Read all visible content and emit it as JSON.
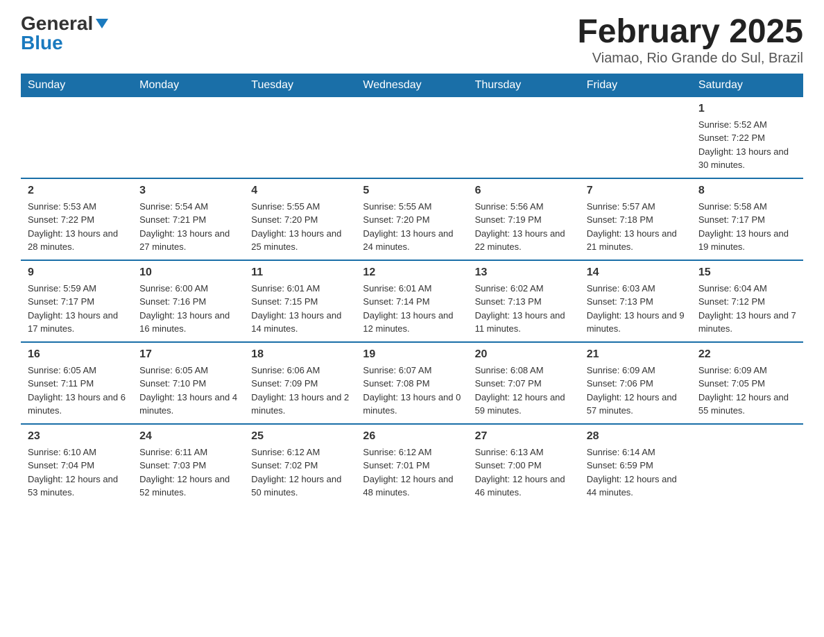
{
  "logo": {
    "general": "General",
    "blue": "Blue"
  },
  "title": {
    "month": "February 2025",
    "location": "Viamao, Rio Grande do Sul, Brazil"
  },
  "weekdays": [
    "Sunday",
    "Monday",
    "Tuesday",
    "Wednesday",
    "Thursday",
    "Friday",
    "Saturday"
  ],
  "weeks": [
    [
      {
        "day": "",
        "info": ""
      },
      {
        "day": "",
        "info": ""
      },
      {
        "day": "",
        "info": ""
      },
      {
        "day": "",
        "info": ""
      },
      {
        "day": "",
        "info": ""
      },
      {
        "day": "",
        "info": ""
      },
      {
        "day": "1",
        "info": "Sunrise: 5:52 AM\nSunset: 7:22 PM\nDaylight: 13 hours and 30 minutes."
      }
    ],
    [
      {
        "day": "2",
        "info": "Sunrise: 5:53 AM\nSunset: 7:22 PM\nDaylight: 13 hours and 28 minutes."
      },
      {
        "day": "3",
        "info": "Sunrise: 5:54 AM\nSunset: 7:21 PM\nDaylight: 13 hours and 27 minutes."
      },
      {
        "day": "4",
        "info": "Sunrise: 5:55 AM\nSunset: 7:20 PM\nDaylight: 13 hours and 25 minutes."
      },
      {
        "day": "5",
        "info": "Sunrise: 5:55 AM\nSunset: 7:20 PM\nDaylight: 13 hours and 24 minutes."
      },
      {
        "day": "6",
        "info": "Sunrise: 5:56 AM\nSunset: 7:19 PM\nDaylight: 13 hours and 22 minutes."
      },
      {
        "day": "7",
        "info": "Sunrise: 5:57 AM\nSunset: 7:18 PM\nDaylight: 13 hours and 21 minutes."
      },
      {
        "day": "8",
        "info": "Sunrise: 5:58 AM\nSunset: 7:17 PM\nDaylight: 13 hours and 19 minutes."
      }
    ],
    [
      {
        "day": "9",
        "info": "Sunrise: 5:59 AM\nSunset: 7:17 PM\nDaylight: 13 hours and 17 minutes."
      },
      {
        "day": "10",
        "info": "Sunrise: 6:00 AM\nSunset: 7:16 PM\nDaylight: 13 hours and 16 minutes."
      },
      {
        "day": "11",
        "info": "Sunrise: 6:01 AM\nSunset: 7:15 PM\nDaylight: 13 hours and 14 minutes."
      },
      {
        "day": "12",
        "info": "Sunrise: 6:01 AM\nSunset: 7:14 PM\nDaylight: 13 hours and 12 minutes."
      },
      {
        "day": "13",
        "info": "Sunrise: 6:02 AM\nSunset: 7:13 PM\nDaylight: 13 hours and 11 minutes."
      },
      {
        "day": "14",
        "info": "Sunrise: 6:03 AM\nSunset: 7:13 PM\nDaylight: 13 hours and 9 minutes."
      },
      {
        "day": "15",
        "info": "Sunrise: 6:04 AM\nSunset: 7:12 PM\nDaylight: 13 hours and 7 minutes."
      }
    ],
    [
      {
        "day": "16",
        "info": "Sunrise: 6:05 AM\nSunset: 7:11 PM\nDaylight: 13 hours and 6 minutes."
      },
      {
        "day": "17",
        "info": "Sunrise: 6:05 AM\nSunset: 7:10 PM\nDaylight: 13 hours and 4 minutes."
      },
      {
        "day": "18",
        "info": "Sunrise: 6:06 AM\nSunset: 7:09 PM\nDaylight: 13 hours and 2 minutes."
      },
      {
        "day": "19",
        "info": "Sunrise: 6:07 AM\nSunset: 7:08 PM\nDaylight: 13 hours and 0 minutes."
      },
      {
        "day": "20",
        "info": "Sunrise: 6:08 AM\nSunset: 7:07 PM\nDaylight: 12 hours and 59 minutes."
      },
      {
        "day": "21",
        "info": "Sunrise: 6:09 AM\nSunset: 7:06 PM\nDaylight: 12 hours and 57 minutes."
      },
      {
        "day": "22",
        "info": "Sunrise: 6:09 AM\nSunset: 7:05 PM\nDaylight: 12 hours and 55 minutes."
      }
    ],
    [
      {
        "day": "23",
        "info": "Sunrise: 6:10 AM\nSunset: 7:04 PM\nDaylight: 12 hours and 53 minutes."
      },
      {
        "day": "24",
        "info": "Sunrise: 6:11 AM\nSunset: 7:03 PM\nDaylight: 12 hours and 52 minutes."
      },
      {
        "day": "25",
        "info": "Sunrise: 6:12 AM\nSunset: 7:02 PM\nDaylight: 12 hours and 50 minutes."
      },
      {
        "day": "26",
        "info": "Sunrise: 6:12 AM\nSunset: 7:01 PM\nDaylight: 12 hours and 48 minutes."
      },
      {
        "day": "27",
        "info": "Sunrise: 6:13 AM\nSunset: 7:00 PM\nDaylight: 12 hours and 46 minutes."
      },
      {
        "day": "28",
        "info": "Sunrise: 6:14 AM\nSunset: 6:59 PM\nDaylight: 12 hours and 44 minutes."
      },
      {
        "day": "",
        "info": ""
      }
    ]
  ]
}
